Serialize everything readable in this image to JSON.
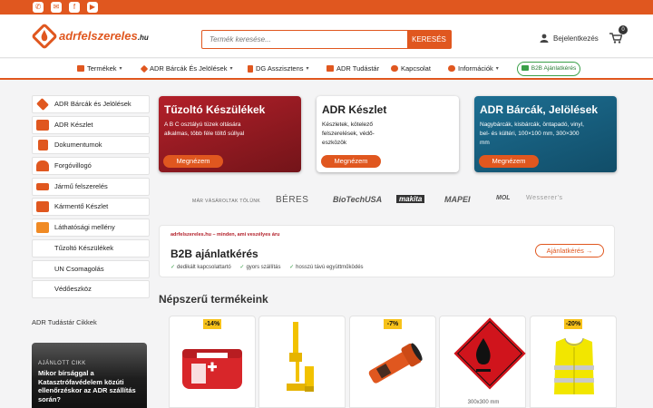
{
  "colors": {
    "accent": "#e0571f",
    "red_card": "#b3202a",
    "teal_card": "#1d6f93",
    "green": "#3aa048",
    "badge_yellow": "#f7c21a"
  },
  "topbar": {
    "icons": [
      "phone-icon",
      "mail-icon",
      "facebook-icon",
      "youtube-icon"
    ]
  },
  "header": {
    "logo": {
      "orange": "adrfelszereles",
      "suffix": ".hu"
    },
    "search": {
      "placeholder": "Termék keresése...",
      "button": "KERESÉS"
    },
    "login": "Bejelentkezés",
    "cart_count": "0"
  },
  "nav": {
    "items": [
      {
        "label": "Termékek",
        "has_dropdown": true
      },
      {
        "label": "ADR Bárcák És Jelölések",
        "has_dropdown": true
      },
      {
        "label": "DG Asszisztens",
        "has_dropdown": true
      },
      {
        "label": "ADR Tudástár",
        "has_dropdown": false
      },
      {
        "label": "Kapcsolat",
        "has_dropdown": false
      },
      {
        "label": "Információk",
        "has_dropdown": true
      }
    ],
    "b2b_pill": "B2B Ajánlatkérés"
  },
  "sidebar": {
    "items": [
      {
        "label": "ADR Bárcák és Jelölések"
      },
      {
        "label": "ADR Készlet"
      },
      {
        "label": "Dokumentumok"
      },
      {
        "label": "Forgóvillogó"
      },
      {
        "label": "Jármű felszerelés"
      },
      {
        "label": "Kármentő Készlet"
      },
      {
        "label": "Láthatósági mellény"
      },
      {
        "label": "Tűzoltó Készülékek"
      },
      {
        "label": "UN Csomagolás"
      },
      {
        "label": "Védőeszköz"
      }
    ],
    "blog_heading": "ADR Tudástár Cikkek",
    "blog": {
      "tag": "AJÁNLOTT CIKK",
      "title": "Mikor bírsággal a Katasztrófavédelem közúti ellenőrzéskor az ADR szállítás során?"
    }
  },
  "promos": [
    {
      "title": "Tűzoltó Készülékek",
      "text": "A B C osztályú tüzek oltására alkalmas, több féle töltő súllyal",
      "button": "Megnézem"
    },
    {
      "title": "ADR Készlet",
      "text": "Készletek, kötelező felszerelések, védő-eszközök",
      "button": "Megnézem"
    },
    {
      "title": "ADR Bárcák, Jelölések",
      "text": "Nagybárcák, kisbárcák, öntapadó, vinyl, bel- és kültéri, 100×100 mm, 300×300 mm",
      "button": "Megnézem"
    }
  ],
  "brands": {
    "label": "MÁR VÁSÁROLTAK TŐLÜNK",
    "names": [
      "BÉRES",
      "BioTechUSA",
      "makita",
      "MAPEI",
      "MOL",
      "Wesserer's"
    ]
  },
  "b2b": {
    "kicker": "adrfelszereles.hu – minden, ami veszélyes áru",
    "title": "B2B ajánlatkérés",
    "checks": [
      "dedikált kapcsolattartó",
      "gyors szállítás",
      "hosszú távú együttműködés"
    ],
    "button": "Ajánlatkérés →"
  },
  "popular": {
    "title": "Népszerű termékeink",
    "products": [
      {
        "badge": "-14%",
        "image": "first-aid-kit",
        "size": ""
      },
      {
        "badge": "",
        "image": "yellow-security-seal",
        "size": ""
      },
      {
        "badge": "-7%",
        "image": "orange-flashlight",
        "size": ""
      },
      {
        "badge": "",
        "image": "flammable-placard",
        "size": "300x300 mm"
      },
      {
        "badge": "-20%",
        "image": "hi-vis-vest",
        "size": ""
      }
    ]
  }
}
